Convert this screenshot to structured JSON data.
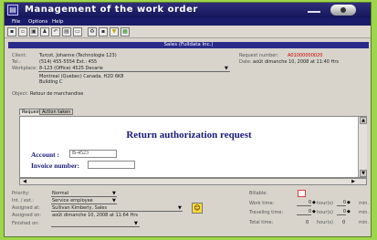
{
  "window": {
    "title": "Management of the work order",
    "icon": "clipboard-icon"
  },
  "menu": [
    "File",
    "Options",
    "Help"
  ],
  "toolbar": [
    {
      "icon": "save-icon",
      "glyph": "▪"
    },
    {
      "icon": "folder-icon",
      "glyph": "▫"
    },
    {
      "icon": "clipboard-icon",
      "glyph": "▣"
    },
    {
      "icon": "people-icon",
      "glyph": "♟"
    },
    {
      "icon": "back-arrow-icon",
      "glyph": "↶"
    },
    {
      "icon": "document-icon",
      "glyph": "▤"
    },
    {
      "icon": "note-icon",
      "glyph": "▭"
    },
    {
      "icon": "recycle-icon",
      "glyph": "♻"
    },
    {
      "icon": "folder-icon",
      "glyph": "▪"
    },
    {
      "icon": "filter-icon",
      "glyph": "▼"
    },
    {
      "icon": "grid-icon",
      "glyph": "▦"
    }
  ],
  "section": "Sales  (Fulldata Inc.)",
  "client": {
    "client_label": "Client:",
    "client_value": "Turcot, Johanne (Technologie 123)",
    "tel_label": "Tel.:",
    "tel_value": "(514) 455-5554  Ext.:  455",
    "workplace_label": "Workplace:",
    "workplace_value": "8-123 (Office) 4525 Decarie",
    "address_line1": "Montreal (Quebec) Canada,  H2D 6K8",
    "address_line2": "Building C",
    "request_label": "Request number:",
    "request_value": "A01000000020",
    "date_label": "Date:",
    "date_value": "août dimanche 10, 2008 at 11:40 Hrs",
    "object_label": "Object:",
    "object_value": "Retour de marchandise"
  },
  "tabs": [
    "Request",
    "Action taken"
  ],
  "document": {
    "title": "Return authorization request",
    "account_label": "Account :",
    "account_value": "B-4523",
    "invoice_label": "Invoice number:",
    "invoice_value": ""
  },
  "bottom": {
    "priority_label": "Priority:",
    "priority_value": "Normal",
    "intext_label": "Int. / ext.:",
    "intext_value": "Service employee",
    "assigned_to_label": "Assigned at:",
    "assigned_to_value": "Sullivan Kimberly,  Sales",
    "assigned_on_label": "Assigned on:",
    "assigned_on_value": "août dimanche 10, 2008 at 11:64 Hrs",
    "finished_label": "Finished on:",
    "finished_value": "",
    "billable_label": "Billable:",
    "work_label": "Work time:",
    "work_hours": "0",
    "work_min": "0",
    "travel_label": "Traveling time:",
    "travel_hours": "0",
    "travel_min": "0",
    "total_label": "Total time:",
    "total_hours": "0",
    "total_min": "0",
    "hours_unit": "hour(s)",
    "min_unit": "min."
  },
  "colors": {
    "titlebar": "#1b1b6b",
    "accent": "#2a2a8a",
    "request_number": "#cc0000",
    "background": "#9fd54a"
  }
}
